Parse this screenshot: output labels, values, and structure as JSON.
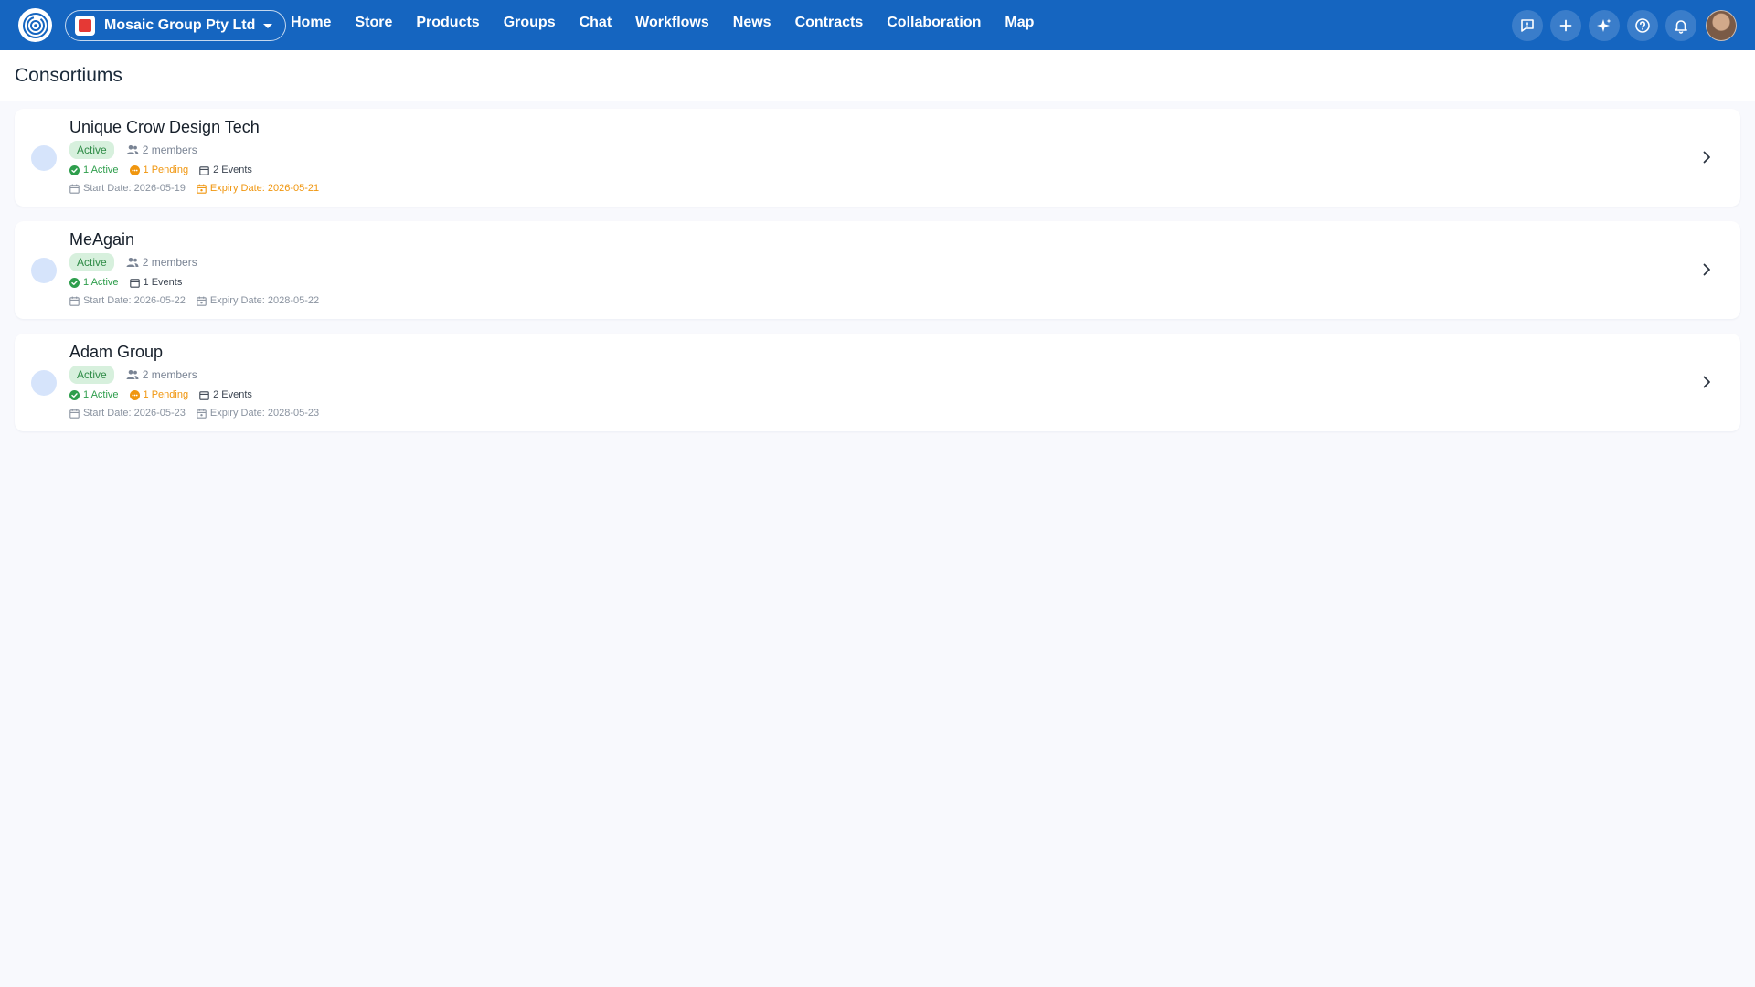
{
  "app": {
    "org_name": "Mosaic Group Pty Ltd"
  },
  "nav": {
    "items": [
      "Home",
      "Store",
      "Products",
      "Groups",
      "Chat",
      "Workflows",
      "News",
      "Contracts",
      "Collaboration",
      "Map"
    ]
  },
  "actions": {
    "icons": [
      "feedback-icon",
      "plus-icon",
      "sparkle-icon",
      "help-icon",
      "bell-icon"
    ]
  },
  "page": {
    "title": "Consortiums"
  },
  "consortiums": [
    {
      "name": "Unique Crow Design Tech",
      "status": "Active",
      "members": "2 members",
      "active": "1 Active",
      "pending": "1 Pending",
      "events": "2 Events",
      "start_date": "Start Date: 2026-05-19",
      "expiry_date": "Expiry Date: 2026-05-21",
      "expiry_warning": true
    },
    {
      "name": "MeAgain",
      "status": "Active",
      "members": "2 members",
      "active": "1 Active",
      "pending": null,
      "events": "1 Events",
      "start_date": "Start Date: 2026-05-22",
      "expiry_date": "Expiry Date: 2028-05-22",
      "expiry_warning": false
    },
    {
      "name": "Adam Group",
      "status": "Active",
      "members": "2 members",
      "active": "1 Active",
      "pending": "1 Pending",
      "events": "2 Events",
      "start_date": "Start Date: 2026-05-23",
      "expiry_date": "Expiry Date: 2028-05-23",
      "expiry_warning": false
    }
  ],
  "colors": {
    "brand": "#1565c0",
    "active": "#2e9e4c",
    "pending": "#f0960f",
    "background": "#f8f9fd"
  }
}
